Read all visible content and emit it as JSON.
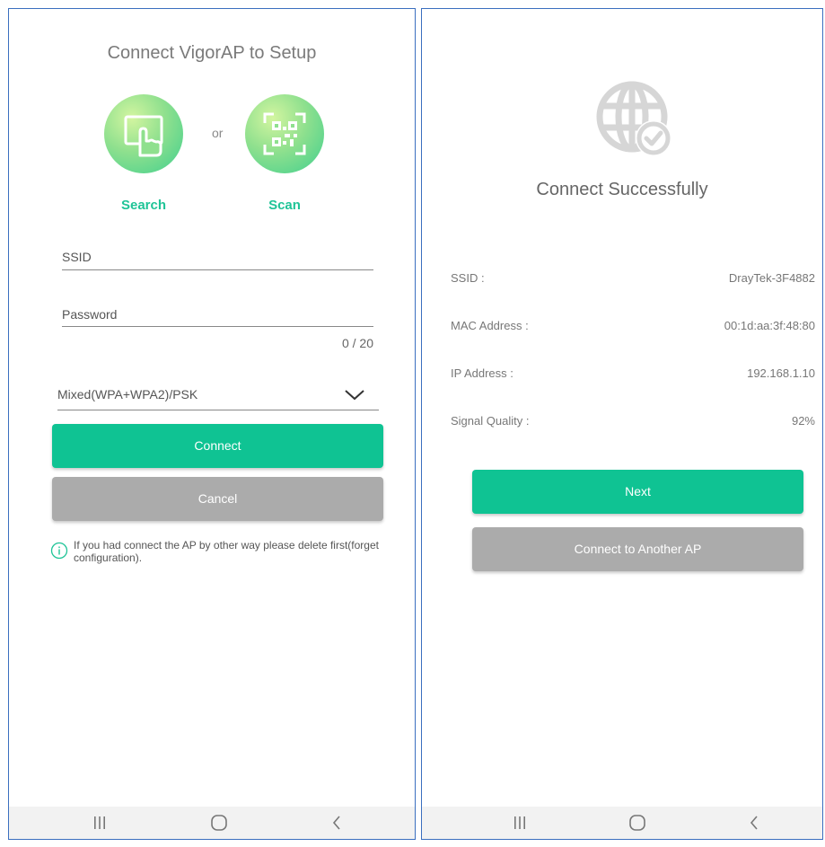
{
  "setup_screen": {
    "title": "Connect VigorAP to Setup",
    "or_text": "or",
    "search_label": "Search",
    "scan_label": "Scan",
    "ssid_placeholder": "SSID",
    "password_placeholder": "Password",
    "password_counter": "0 / 20",
    "security_selected": "Mixed(WPA+WPA2)/PSK",
    "connect_label": "Connect",
    "cancel_label": "Cancel",
    "info_note": "If you had connect the AP by other way please delete first(forget configuration)."
  },
  "result_screen": {
    "title": "Connect Successfully",
    "rows": [
      {
        "label": "SSID :",
        "value": "DrayTek-3F4882"
      },
      {
        "label": "MAC Address :",
        "value": "00:1d:aa:3f:48:80"
      },
      {
        "label": "IP Address :",
        "value": "192.168.1.10"
      },
      {
        "label": "Signal Quality :",
        "value": "92%"
      }
    ],
    "next_label": "Next",
    "another_label": "Connect to Another AP"
  },
  "colors": {
    "accent_green": "#0fc393",
    "label_green": "#1fc497",
    "button_gray": "#ababab",
    "frame_blue": "#3b6fbf"
  },
  "icons": {
    "search": "hand-pointer-icon",
    "scan": "qr-code-icon",
    "success": "globe-check-icon",
    "info": "info-icon",
    "nav_recents": "recents-icon",
    "nav_home": "home-icon",
    "nav_back": "back-icon",
    "dropdown": "chevron-down-icon"
  }
}
